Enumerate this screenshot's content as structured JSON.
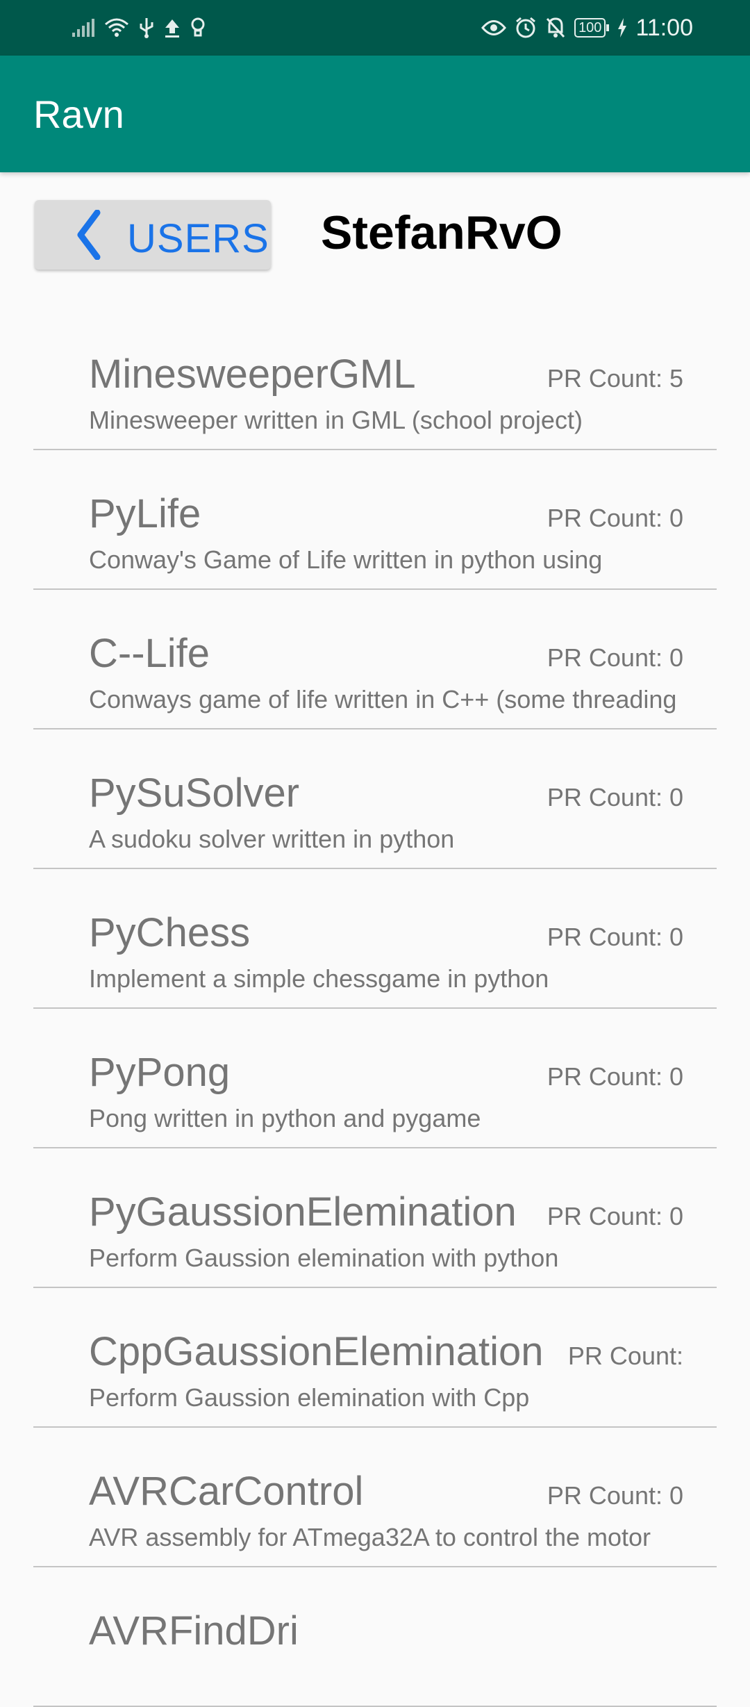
{
  "status_bar": {
    "time": "11:00",
    "battery": "100",
    "icons_left": [
      "signal-icon",
      "wifi-icon",
      "usb-icon",
      "upload-icon",
      "bulb-icon"
    ],
    "icons_right": [
      "eye-icon",
      "alarm-icon",
      "notifications-off-icon",
      "battery-icon",
      "charging-icon"
    ]
  },
  "app_bar": {
    "title": "Ravn"
  },
  "header": {
    "back_label": "USERS",
    "user_name": "StefanRvO"
  },
  "repos": [
    {
      "name": "MinesweeperGML",
      "pr_count": "PR Count: 5",
      "description": "Minesweeper written in GML (school project)"
    },
    {
      "name": "PyLife",
      "pr_count": "PR Count: 0",
      "description": "Conway's Game of Life written in python using"
    },
    {
      "name": "C--Life",
      "pr_count": "PR Count: 0",
      "description": "Conways game of life written in C++ (some threading"
    },
    {
      "name": "PySuSolver",
      "pr_count": "PR Count: 0",
      "description": "A sudoku solver written in python"
    },
    {
      "name": "PyChess",
      "pr_count": "PR Count: 0",
      "description": "Implement a simple chessgame in python"
    },
    {
      "name": "PyPong",
      "pr_count": "PR Count: 0",
      "description": "Pong written in python and pygame"
    },
    {
      "name": "PyGaussionElemination",
      "pr_count": "PR Count: 0",
      "description": "Perform Gaussion elemination with python"
    },
    {
      "name": "CppGaussionElemination",
      "pr_count": "PR Count:",
      "description": "Perform Gaussion elemination with Cpp"
    },
    {
      "name": "AVRCarControl",
      "pr_count": "PR Count: 0",
      "description": "AVR assembly for ATmega32A to control the motor"
    },
    {
      "name": "AVRFindDri",
      "pr_count": "",
      "description": ""
    }
  ],
  "colors": {
    "status_bar": "#00584b",
    "app_bar": "#00887a",
    "accent": "#1a73e8",
    "text_secondary": "#757575"
  }
}
